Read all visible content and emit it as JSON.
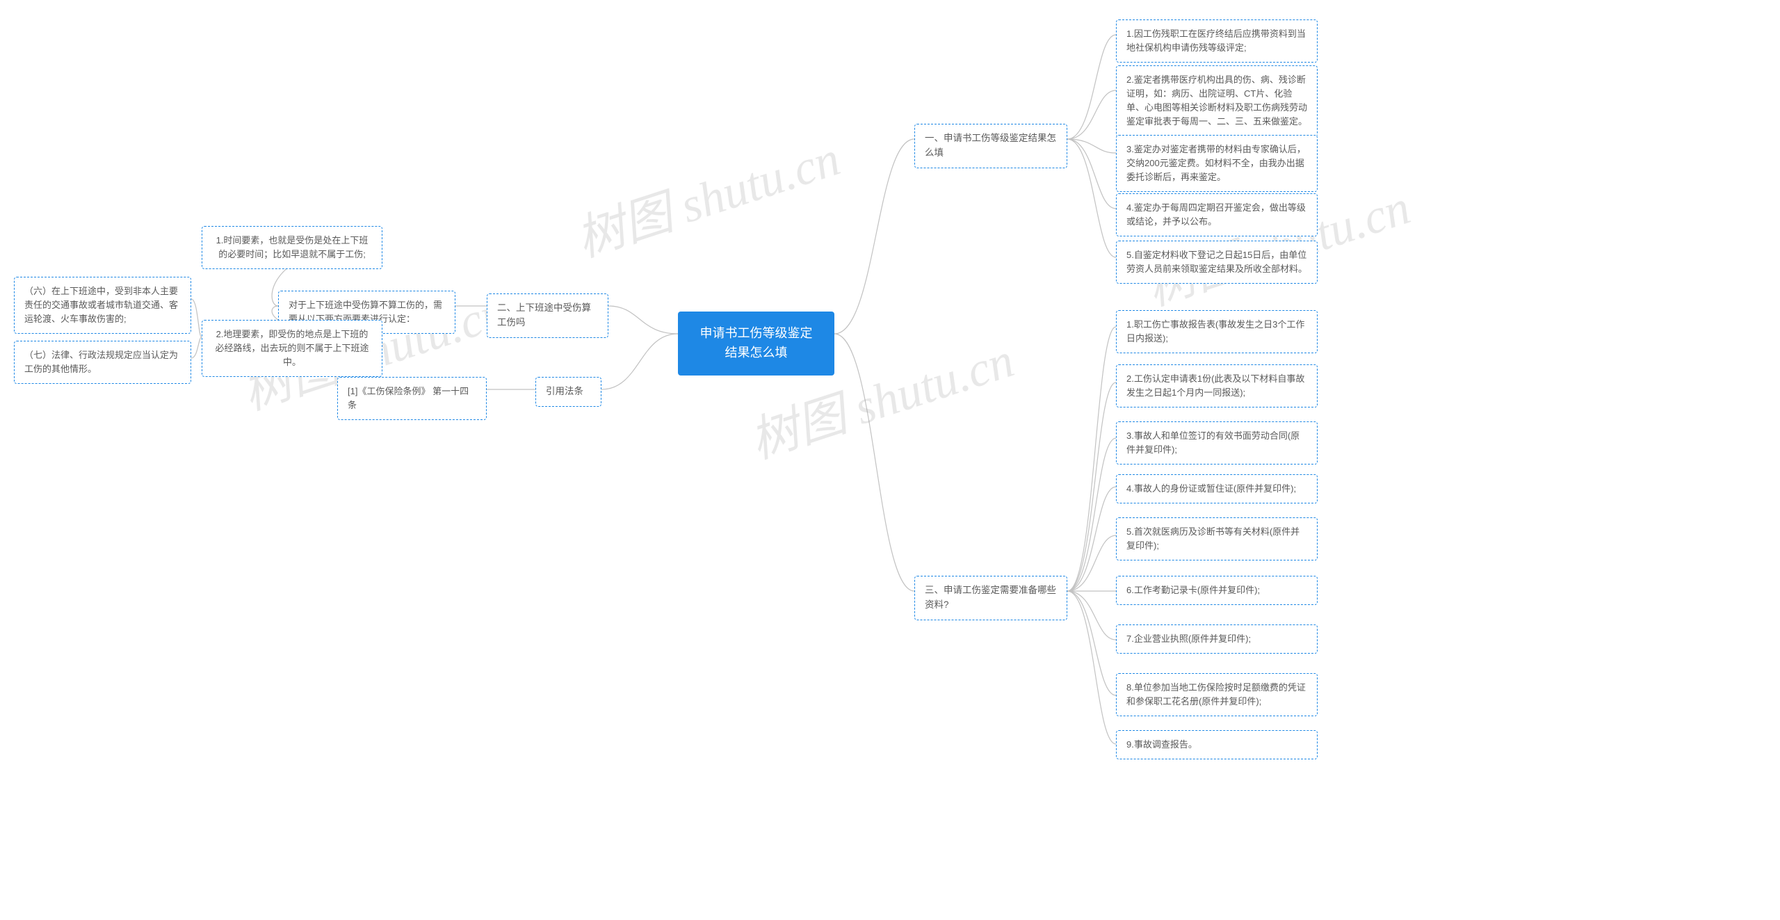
{
  "root": "申请书工伤等级鉴定结果怎么填",
  "s1": {
    "title": "一、申请书工伤等级鉴定结果怎么填",
    "items": [
      "1.因工伤残职工在医疗终结后应携带资料到当地社保机构申请伤残等级评定;",
      "2.鉴定者携带医疗机构出具的伤、病、残诊断证明，如：病历、出院证明、CT片、化验单、心电图等相关诊断材料及职工伤病残劳动鉴定审批表于每周一、二、三、五来做鉴定。",
      "3.鉴定办对鉴定者携带的材料由专家确认后，交纳200元鉴定费。如材料不全，由我办出据委托诊断后，再来鉴定。",
      "4.鉴定办于每周四定期召开鉴定会，做出等级或结论，并予以公布。",
      "5.自鉴定材料收下登记之日起15日后，由单位劳资人员前来领取鉴定结果及所收全部材料。"
    ]
  },
  "s2": {
    "title": "二、上下班途中受伤算工伤吗",
    "intro": "对于上下班途中受伤算不算工伤的，需要从以下两方面要素进行认定：",
    "factors": [
      "1.时间要素，也就是受伤是处在上下班的必要时间；比如早退就不属于工伤;",
      "2.地理要素，即受伤的地点是上下班的必经路线，出去玩的则不属于上下班途中。"
    ],
    "far": [
      "（六）在上下班途中，受到非本人主要责任的交通事故或者城市轨道交通、客运轮渡、火车事故伤害的;",
      "（七）法律、行政法规规定应当认定为工伤的其他情形。"
    ]
  },
  "s3": {
    "title": "三、申请工伤鉴定需要准备哪些资料?",
    "items": [
      "1.职工伤亡事故报告表(事故发生之日3个工作日内报送);",
      "2.工伤认定申请表1份(此表及以下材料自事故发生之日起1个月内一同报送);",
      "3.事故人和单位签订的有效书面劳动合同(原件并复印件);",
      "4.事故人的身份证或暂住证(原件并复印件);",
      "5.首次就医病历及诊断书等有关材料(原件并复印件);",
      "6.工作考勤记录卡(原件并复印件);",
      "7.企业营业执照(原件并复印件);",
      "8.单位参加当地工伤保险按时足额缴费的凭证和参保职工花名册(原件并复印件);",
      "9.事故调查报告。"
    ]
  },
  "cite": {
    "title": "引用法条",
    "item": "[1]《工伤保险条例》 第一十四条"
  },
  "watermark": "树图 shutu.cn"
}
